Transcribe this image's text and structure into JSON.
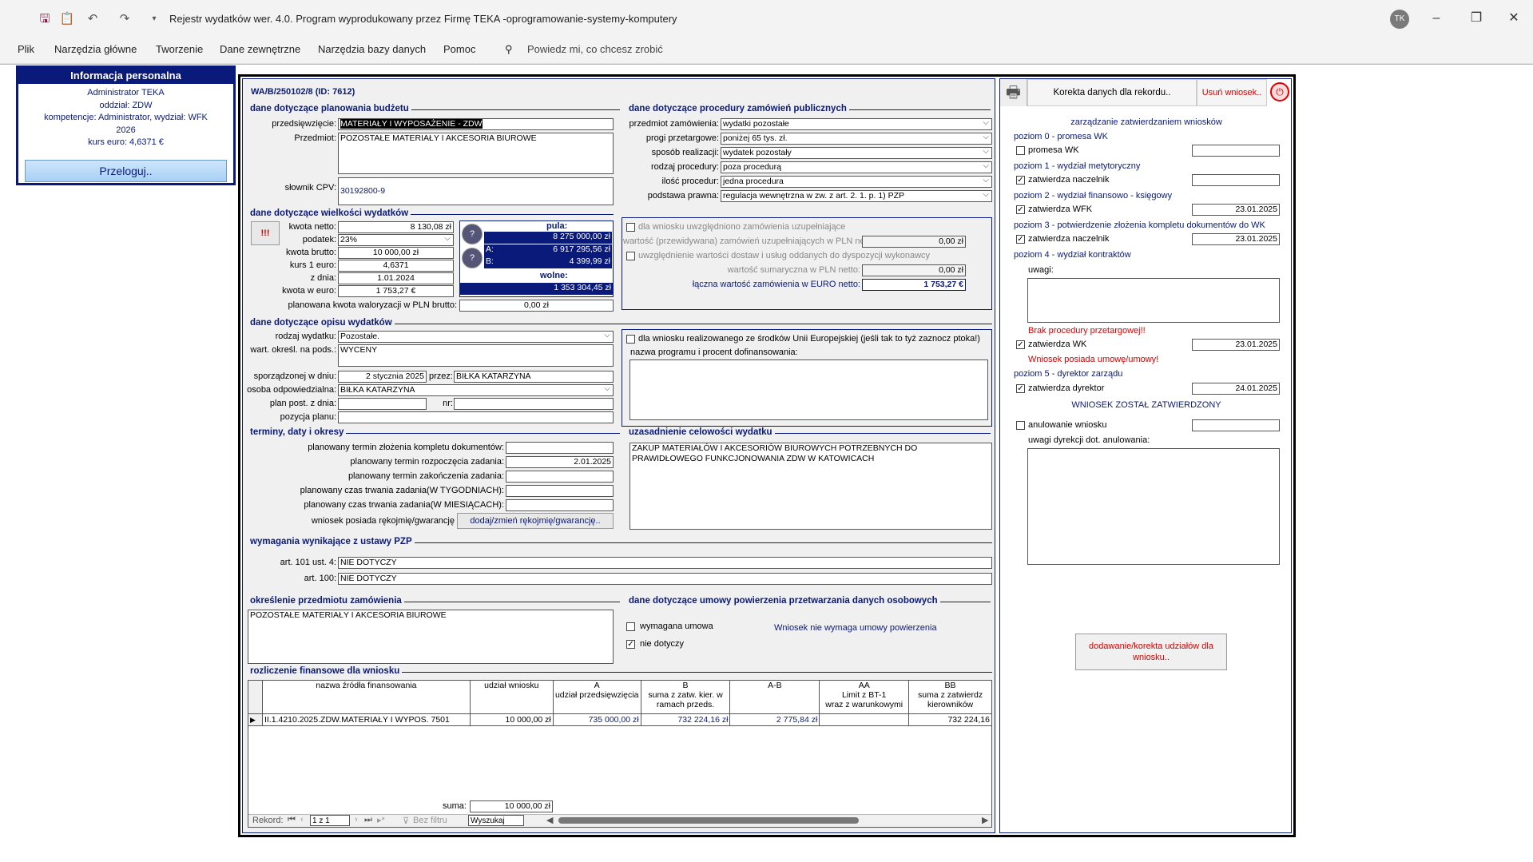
{
  "titlebar": {
    "title": "Rejestr wydatków wer. 4.0.  Program wyprodukowany przez Firmę TEKA -oprogramowanie-systemy-komputery",
    "user_initials": "TK"
  },
  "ribbon": {
    "tabs": [
      "Plik",
      "Narzędzia główne",
      "Tworzenie",
      "Dane zewnętrzne",
      "Narzędzia bazy danych",
      "Pomoc"
    ],
    "tell_me": "Powiedz mi, co chcesz zrobić"
  },
  "info": {
    "title": "Informacja personalna",
    "user": "Administrator TEKA",
    "dept": "oddział: ZDW",
    "competence": "kompetencje: Administrator, wydział: WFK",
    "year": "2026",
    "rate": "kurs euro: 4,6371 €",
    "relogin": "Przeloguj.."
  },
  "record": {
    "id": "WA/B/250102/8 (ID: 7612)"
  },
  "budget": {
    "section": "dane dotyczące planowania budżetu",
    "undertaking_label": "przedsięwzięcie:",
    "undertaking": "MATERIAŁY I WYPOSAŻENIE - ZDW",
    "subject_label": "Przedmiot:",
    "subject": "POZOSTAŁE MATERIAŁY I AKCESORIA BIUROWE",
    "cpv_label": "słownik CPV:",
    "cpv": "30192800-9"
  },
  "amounts": {
    "section": "dane dotyczące wielkości wydatków",
    "warn": "!!!",
    "net_label": "kwota netto:",
    "net": "8 130,08 zł",
    "tax_label": "podatek:",
    "tax": "23%",
    "gross_label": "kwota brutto:",
    "gross": "10 000,00 zł",
    "rate_label": "kurs 1 euro:",
    "rate": "4,6371",
    "date_label": "z dnia:",
    "date": "1.01.2024",
    "eur_label": "kwota w euro:",
    "eur": "1 753,27 €",
    "pool_label": "pula:",
    "pool": "8 275 000,00 zł",
    "a_label": "A:",
    "a": "6 917 295,56 zł",
    "b_label": "B:",
    "b": "4 399,99 zł",
    "free_label": "wolne:",
    "free": "1 353 304,45 zł",
    "valor_label": "planowana kwota waloryzacji w PLN brutto:",
    "valor": "0,00 zł"
  },
  "procurement": {
    "section": "dane dotyczące procedury zamówień publicznych",
    "subject_label": "przedmiot zamówienia:",
    "subject": "wydatki pozostałe",
    "threshold_label": "progi przetargowe:",
    "threshold": "poniżej 65 tys. zł.",
    "method_label": "sposób realizacji:",
    "method": "wydatek pozostały",
    "proc_type_label": "rodzaj procedury:",
    "proc_type": "poza procedurą",
    "proc_count_label": "ilość procedur:",
    "proc_count": "jedna procedura",
    "legal_label": "podstawa prawna:",
    "legal": "regulacja wewnętrzna w zw. z art. 2. 1. p. 1) PZP",
    "suppl_cb": "dla wniosku uwzględniono zamówienia uzupełniające",
    "suppl_val_label": "wartość (przewidywana) zamówień uzupełniających w PLN netto:",
    "suppl_val": "0,00 zł",
    "incl_cb": "uwzględnienie wartości dostaw i usług oddanych do dyspozycji wykonawcy",
    "sum_label": "wartość sumaryczna w PLN netto:",
    "sum": "0,00 zł",
    "total_eur_label": "łączna wartość zamówienia w EURO netto:",
    "total_eur": "1 753,27 €"
  },
  "description": {
    "section": "dane dotyczące opisu wydatków",
    "kind_label": "rodzaj wydatku:",
    "kind": "Pozostałe.",
    "basis_label": "wart. określ. na pods.:",
    "basis": "WYCENY",
    "prepared_label": "sporządzonej w dniu:",
    "prepared": "2 stycznia 2025",
    "by_label": "przez:",
    "by": "BIŁKA KATARZYNA",
    "responsible_label": "osoba odpowiedzialna:",
    "responsible": "BIŁKA KATARZYNA",
    "plan_label": "plan post. z dnia:",
    "plan": "",
    "nr_label": "nr:",
    "nr": "",
    "position_label": "pozycja planu:",
    "position": "",
    "eu_cb": "dla wniosku realizowanego ze środków Unii Europejskiej (jeśli tak to tyż zaznocz ptoka!)",
    "eu_prog_label": "nazwa programu i procent dofinansowania:",
    "eu_prog": ""
  },
  "terms": {
    "section": "terminy, daty i okresy",
    "t1_label": "planowany termin złożenia kompletu dokumentów:",
    "t1": "",
    "t2_label": "planowany termin rozpoczęcia zadania:",
    "t2": "2.01.2025",
    "t3_label": "planowany termin zakończenia zadania:",
    "t3": "",
    "t4_label": "planowany czas trwania zadania(W TYGODNIACH):",
    "t4": "",
    "t5_label": "planowany czas trwania zadania(W MIESIĄCACH):",
    "t5": "",
    "warranty_label": "wniosek posiada rękojmię/gwarancję",
    "warranty_btn": "dodaj/zmień rękojmię/gwarancję.."
  },
  "justification": {
    "section": "uzasadnienie celowości wydatku",
    "text": "ZAKUP MATERIAŁÓW I AKCESORIÓW BIUROWYCH POTRZEBNYCH DO PRAWIDŁOWEGO FUNKCJONOWANIA ZDW W KATOWICACH"
  },
  "pzp": {
    "section": "wymagania wynikające z ustawy PZP",
    "art101_label": "art. 101 ust. 4:",
    "art101": "NIE DOTYCZY",
    "art100_label": "art. 100:",
    "art100": "NIE DOTYCZY"
  },
  "subject_def": {
    "section": "określenie przedmiotu zamówienia",
    "text": "POZOSTAŁE MATERIAŁY I AKCESORIA BIUROWE"
  },
  "gdpr": {
    "section": "dane dotyczące umowy powierzenia przetwarzania danych osobowych",
    "required": "wymagana umowa",
    "na": "nie dotyczy",
    "note": "Wniosek nie wymaga umowy powierzenia"
  },
  "finance": {
    "section": "rozliczenie finansowe dla wniosku",
    "headers": [
      "nazwa źródła finansowania",
      "udział wniosku",
      "A\nudział przedsięwzięcia",
      "B\nsuma z zatw. kier. w ramach przeds.",
      "A-B",
      "AA\nLimit z BT-1\nwraz z warunkowymi",
      "BB\nsuma z zatwierdz\nkierowników"
    ],
    "rows": [
      [
        "II.1.4210.2025.ZDW.MATERIAŁY I WYPOS. 7501",
        "10 000,00 zł",
        "735 000,00 zł",
        "732 224,16 zł",
        "2 775,84 zł",
        "",
        "732 224,16"
      ]
    ],
    "sum_label": "suma:",
    "sum": "10 000,00 zł",
    "nav_label": "Rekord:",
    "nav_pos": "1 z 1",
    "filter": "Bez filtru",
    "search": "Wyszukaj"
  },
  "right": {
    "correction": "Korekta danych dla rekordu..",
    "delete": "Usuń wniosek..",
    "mgmt": "zarządzanie zatwierdzaniem wniosków",
    "l0": "poziom 0 - promesa WK",
    "l0c": "promesa WK",
    "l0d": "",
    "l1": "poziom 1 - wydział metytoryczny",
    "l1c": "zatwierdza naczelnik",
    "l1d": "",
    "l2": "poziom 2 - wydział finansowo - księgowy",
    "l2c": "zatwierdza WFK",
    "l2d": "23.01.2025",
    "l3": "poziom 3 - potwierdzenie złożenia kompletu dokumentów do WK",
    "l3c": "zatwierdza naczelnik",
    "l3d": "23.01.2025",
    "l4": "poziom 4 - wydział kontraktów",
    "remarks_label": "uwagi:",
    "remarks": "",
    "no_tender": "Brak procedury przetargowej!!",
    "l4c": "zatwierdza WK",
    "l4d": "23.01.2025",
    "contract": "Wniosek posiada umowę/umowy!",
    "l5": "poziom 5 - dyrektor zarządu",
    "l5c": "zatwierdza dyrektor",
    "l5d": "24.01.2025",
    "approved": "WNIOSEK ZOSTAŁ ZATWIERDZONY",
    "cancel_c": "anulowanie wniosku",
    "cancel_d": "",
    "cancel_remarks_label": "uwagi dyrekcji dot. anulowania:",
    "cancel_remarks": "",
    "shares_btn": "dodawanie/korekta udziałów dla wniosku.."
  },
  "colors": {
    "navy": "#0a1a7a",
    "red": "#dd0000"
  }
}
